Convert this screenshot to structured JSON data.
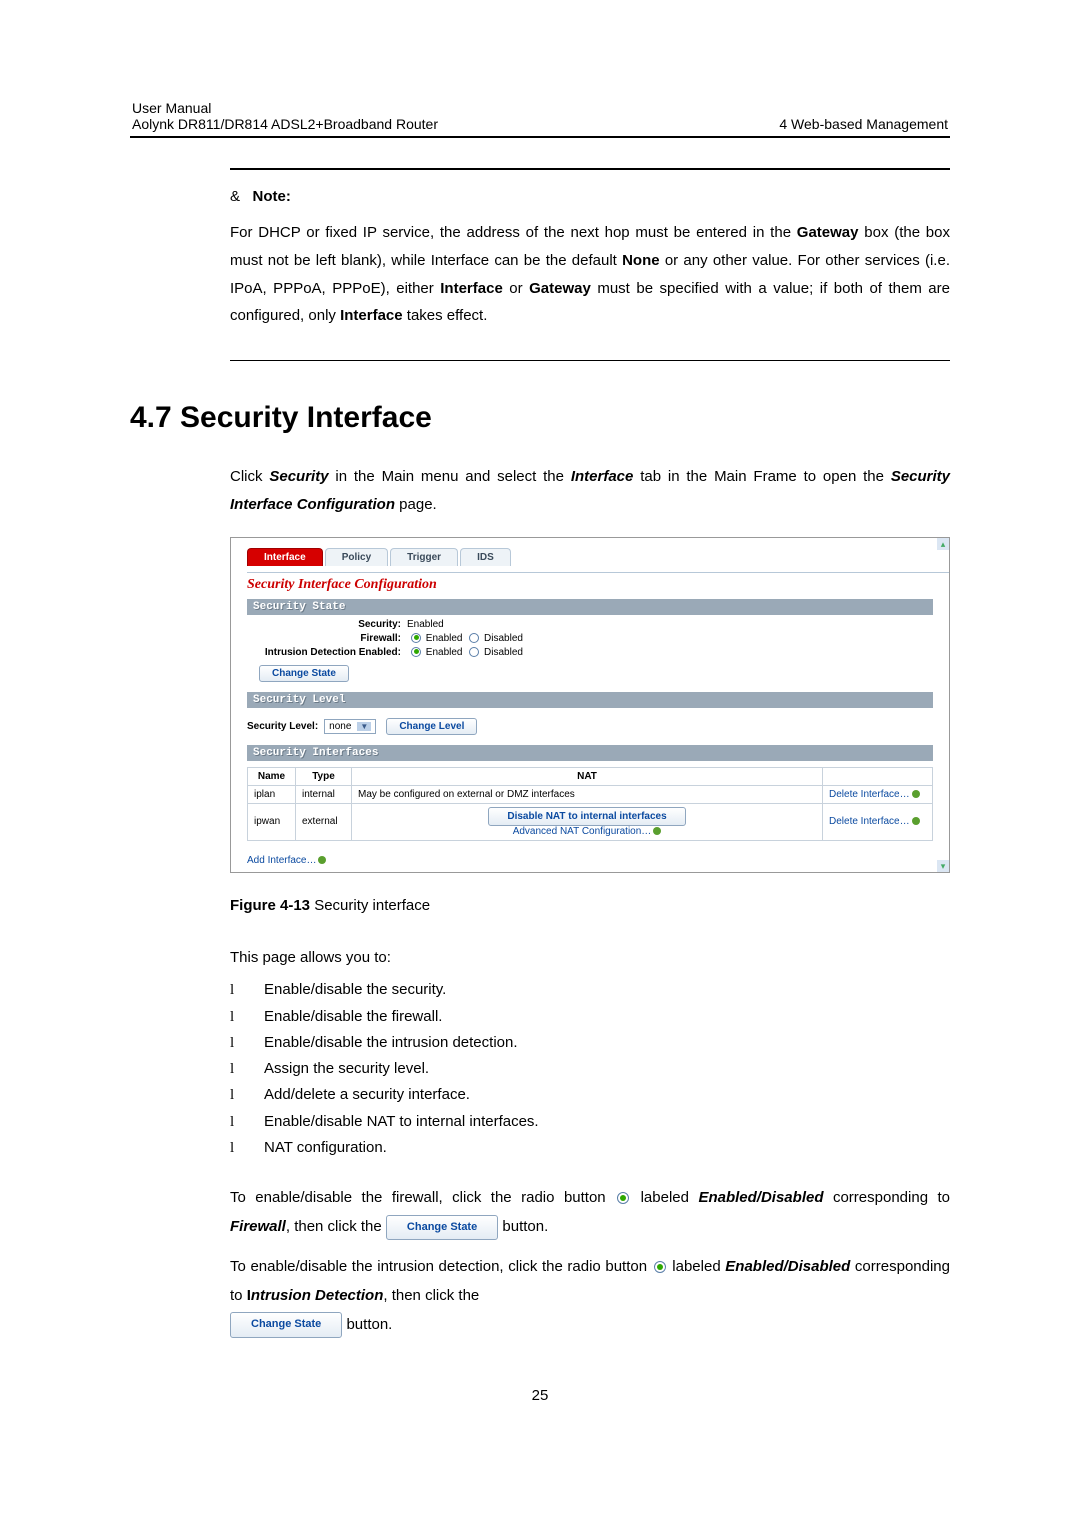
{
  "header": {
    "left_line1": "User Manual",
    "left_line2": "Aolynk DR811/DR814 ADSL2+Broadband Router",
    "right": "4  Web-based Management"
  },
  "note": {
    "marker": "&",
    "label": "Note:",
    "body_1": "For DHCP or fixed IP service, the address of the next hop must be entered in the ",
    "b_gateway": "Gateway",
    "body_2": " box (the box must not be left blank), while Interface can be the default ",
    "b_none": "None",
    "body_3": " or any other value. For other services (i.e. IPoA, PPPoA, PPPoE), either ",
    "b_interface": "Interface",
    "body_4": " or ",
    "b_gateway2": "Gateway",
    "body_5": " must be specified with a value; if both of them are configured, only ",
    "b_interface2": "Interface",
    "body_6": " takes effect."
  },
  "section": {
    "heading": "4.7  Security Interface"
  },
  "intro": {
    "t1": "Click ",
    "b_security": "Security",
    "t2": " in the Main menu and select the ",
    "b_interface": "Interface",
    "t3": " tab in the Main Frame to open the ",
    "b_page": "Security Interface Configuration",
    "t4": " page."
  },
  "fig": {
    "tabs": {
      "interface": "Interface",
      "policy": "Policy",
      "trigger": "Trigger",
      "ids": "IDS"
    },
    "title": "Security Interface Configuration",
    "state_bar": "Security State",
    "state": {
      "security_lbl": "Security:",
      "security_val": "Enabled",
      "firewall_lbl": "Firewall:",
      "ids_lbl": "Intrusion Detection Enabled:",
      "enabled": "Enabled",
      "disabled": "Disabled",
      "change_state": "Change State"
    },
    "level_bar": "Security Level",
    "level": {
      "lbl": "Security Level:",
      "value": "none",
      "change": "Change Level"
    },
    "ifaces_bar": "Security Interfaces",
    "table": {
      "h_name": "Name",
      "h_type": "Type",
      "h_nat": "NAT",
      "rows": [
        {
          "name": "iplan",
          "type": "internal",
          "nat": "May be configured on external or DMZ interfaces",
          "action": "Delete Interface…"
        },
        {
          "name": "ipwan",
          "type": "external",
          "nat_btn": "Disable NAT to internal interfaces",
          "adv": "Advanced NAT Configuration…",
          "action": "Delete Interface…"
        }
      ]
    },
    "add_if": "Add Interface…"
  },
  "caption": {
    "prefix": "Figure 4-13 ",
    "text": "Security interface"
  },
  "allow_intro": "This page allows you to:",
  "bullets": [
    "Enable/disable the security.",
    "Enable/disable the firewall.",
    "Enable/disable the intrusion detection.",
    "Assign the security level.",
    "Add/delete a security interface.",
    "Enable/disable NAT to internal interfaces.",
    "NAT configuration."
  ],
  "p2": {
    "t1": "To enable/disable the firewall, click the radio button ",
    "t2": " labeled ",
    "b_ed": "Enabled/Disabled",
    "t3": " corresponding to ",
    "b_fw": "Firewall",
    "t4": ", then click the ",
    "btn": "Change State",
    "t5": " button."
  },
  "p3": {
    "t1": "To enable/disable the intrusion detection, click the radio button ",
    "t2": " labeled ",
    "b_ed": "Enabled/Disabled",
    "t3": " corresponding to ",
    "b_id1": "I",
    "b_id2": "ntrusion Detection",
    "t4": ", then click the ",
    "btn": "Change State",
    "t5": " button."
  },
  "page_num": "25"
}
